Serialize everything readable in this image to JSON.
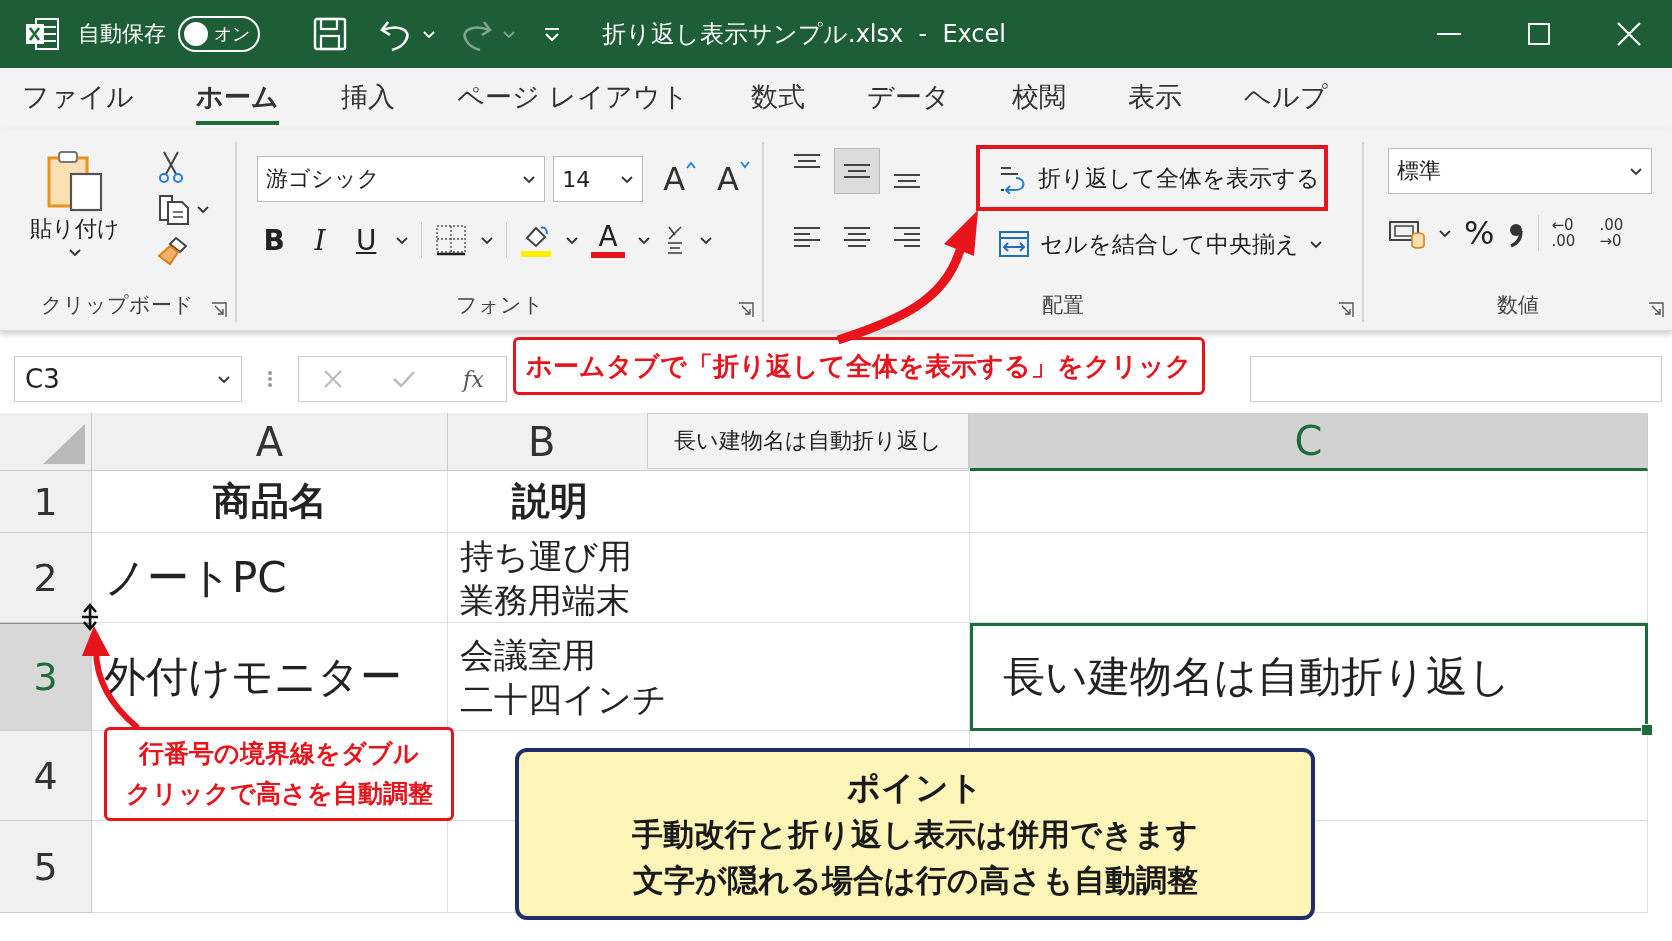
{
  "title_bar": {
    "autosave_label": "自動保存",
    "autosave": {
      "label": "オン",
      "on": true
    },
    "title": "折り返し表示サンプル.xlsx  -  Excel"
  },
  "tabs": [
    {
      "label": "ファイル",
      "selected": false
    },
    {
      "label": "ホーム",
      "selected": true
    },
    {
      "label": "挿入",
      "selected": false
    },
    {
      "label": "ページ レイアウト",
      "selected": false
    },
    {
      "label": "数式",
      "selected": false
    },
    {
      "label": "データ",
      "selected": false
    },
    {
      "label": "校閲",
      "selected": false
    },
    {
      "label": "表示",
      "selected": false
    },
    {
      "label": "ヘルプ",
      "selected": false
    }
  ],
  "ribbon": {
    "clipboard": {
      "paste": "貼り付け",
      "label": "クリップボード"
    },
    "font": {
      "font_name": "游ゴシック",
      "font_size": "14",
      "grow": "A",
      "shrink": "A",
      "bold": "B",
      "italic": "I",
      "underline": "U",
      "font_color": "A",
      "label": "フォント"
    },
    "alignment": {
      "vertical": [
        {
          "kind": "top",
          "selected": false
        },
        {
          "kind": "middle",
          "selected": true
        },
        {
          "kind": "bottom",
          "selected": false
        }
      ],
      "horizontal": [
        {
          "kind": "left",
          "selected": false
        },
        {
          "kind": "center",
          "selected": false
        },
        {
          "kind": "right",
          "selected": false
        }
      ],
      "wrap_text": "折り返して全体を表示する",
      "merge": "セルを結合して中央揃え",
      "label": "配置"
    },
    "number": {
      "format": "標準",
      "percent": "%",
      "decimals": [
        {
          "top": "←0",
          "bottom": ".00"
        },
        {
          "top": ".00",
          "bottom": "→0"
        }
      ],
      "label": "数値"
    }
  },
  "formula_bar": {
    "name_box": "C3",
    "fx": "fx"
  },
  "sheet": {
    "columns": [
      {
        "label": "A",
        "selected": false
      },
      {
        "label": "B",
        "selected": false
      },
      {
        "label": "C",
        "selected": true
      }
    ],
    "rows": [
      {
        "number": "1",
        "selected": false,
        "cells": [
          {
            "lines": [
              "商品名"
            ],
            "kind": "header",
            "selected": false
          },
          {
            "lines": [
              "説明"
            ],
            "kind": "header",
            "selected": false
          },
          {
            "kind": "plain",
            "selected": false
          }
        ]
      },
      {
        "number": "2",
        "selected": false,
        "cells": [
          {
            "lines": [
              "ノートPC"
            ],
            "kind": "large",
            "selected": false
          },
          {
            "lines": [
              "持ち運び用",
              "業務用端末"
            ],
            "kind": "plain",
            "selected": false
          },
          {
            "kind": "plain",
            "selected": false
          }
        ]
      },
      {
        "number": "3",
        "selected": true,
        "cells": [
          {
            "lines": [
              "外付けモニター"
            ],
            "kind": "large",
            "selected": false
          },
          {
            "lines": [
              "会議室用",
              "二十四インチ"
            ],
            "kind": "plain",
            "selected": false
          },
          {
            "lines": [
              "長い建物名は自動折り返し"
            ],
            "kind": "large",
            "selected": true
          }
        ]
      },
      {
        "number": "4",
        "selected": false
      },
      {
        "number": "5",
        "selected": false
      }
    ],
    "tooltip": "長い建物名は自動折り返し"
  },
  "annotations": {
    "top_callout": "ホームタブで「折り返して全体を表示する」をクリック",
    "left_callout": [
      "行番号の境界線をダブル",
      "クリックで高さを自動調整"
    ],
    "point": {
      "title": "ポイント",
      "lines": [
        "手動改行と折り返し表示は併用できます",
        "文字が隠れる場合は行の高さも自動調整"
      ]
    }
  }
}
